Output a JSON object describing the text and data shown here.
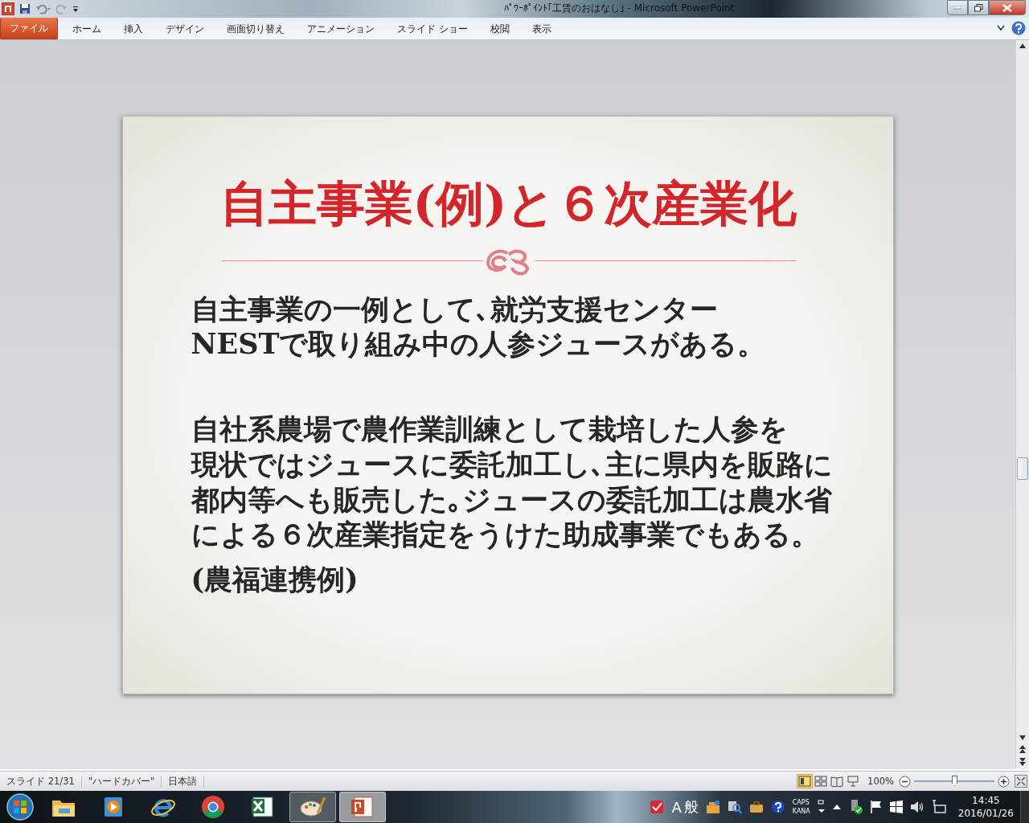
{
  "window": {
    "title": "ﾊﾟﾜｰﾎﾟｲﾝﾄ｢工賃のおはなし｣ - Microsoft PowerPoint"
  },
  "ribbon": {
    "tabs": [
      {
        "label": "ファイル",
        "kind": "file",
        "selected": false
      },
      {
        "label": "ホーム",
        "kind": "tab",
        "selected": false
      },
      {
        "label": "挿入",
        "kind": "tab",
        "selected": false
      },
      {
        "label": "デザイン",
        "kind": "tab",
        "selected": false
      },
      {
        "label": "画面切り替え",
        "kind": "tab",
        "selected": false
      },
      {
        "label": "アニメーション",
        "kind": "tab",
        "selected": false
      },
      {
        "label": "スライド ショー",
        "kind": "tab",
        "selected": false
      },
      {
        "label": "校閲",
        "kind": "tab",
        "selected": false
      },
      {
        "label": "表示",
        "kind": "tab",
        "selected": false
      }
    ]
  },
  "slide": {
    "title": "自主事業(例)と６次産業化",
    "paragraphs": [
      {
        "lines": [
          "自主事業の一例として､就労支援センター",
          "NESTで取り組み中の人参ジュースがある。"
        ]
      },
      {
        "lines": [
          "自社系農場で農作業訓練として栽培した人参を",
          "現状ではジュースに委託加工し､主に県内を販路に",
          "都内等へも販売した｡ジュースの委託加工は農水省",
          "による６次産業指定をうけた助成事業でもある。"
        ]
      },
      {
        "lines": [
          "(農福連携例)"
        ]
      }
    ]
  },
  "status_bar": {
    "slide_info": "スライド 21/31",
    "theme": "\"ハードカバー\"",
    "language": "日本語",
    "views": [
      {
        "selected": true
      },
      {
        "selected": false
      },
      {
        "selected": false
      },
      {
        "selected": false
      }
    ],
    "zoom": "100%",
    "zoom_slider": {
      "level": 0.5
    }
  },
  "taskbar": {
    "apps": [
      {
        "selected": false
      },
      {
        "selected": false
      },
      {
        "selected": false
      },
      {
        "selected": false
      },
      {
        "selected": false
      },
      {
        "selected": false,
        "open": true
      },
      {
        "selected": true,
        "open": true
      }
    ],
    "tray": {
      "ime_mode": "A",
      "ime_kanji": "般",
      "caps": "CAPS",
      "kana": "KANA",
      "time": "14:45",
      "date": "2016/01/26"
    }
  }
}
